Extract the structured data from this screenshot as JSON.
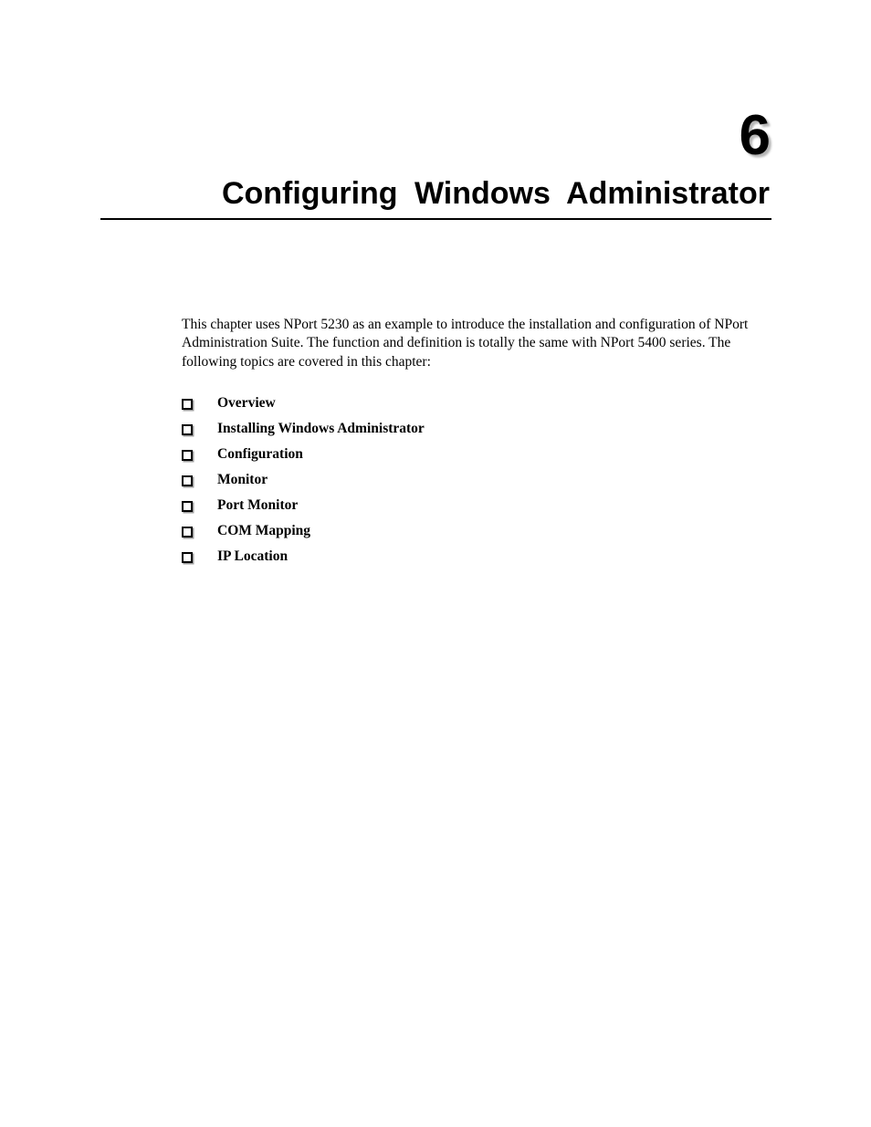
{
  "document": {
    "chapter_number": "6",
    "chapter_title": "Configuring Windows Administrator"
  },
  "intro": {
    "paragraph": "This chapter uses NPort 5230 as an example to introduce the installation and configuration of NPort Administration Suite. The function and definition is totally the same with NPort 5400 series. The following topics are covered in this chapter:"
  },
  "topics": {
    "items": [
      {
        "label": "Overview",
        "bullet": "hollow-square-bullet"
      },
      {
        "label": "Installing Windows Administrator",
        "bullet": "hollow-square-bullet"
      },
      {
        "label": "Configuration",
        "bullet": "hollow-square-bullet"
      },
      {
        "label": "Monitor",
        "bullet": "hollow-square-bullet"
      },
      {
        "label": "Port Monitor",
        "bullet": "hollow-square-bullet"
      },
      {
        "label": "COM Mapping",
        "bullet": "hollow-square-bullet"
      },
      {
        "label": "IP Location",
        "bullet": "hollow-square-bullet"
      }
    ]
  },
  "colors": {
    "page_background": "#ffffff",
    "text": "#000000",
    "rule": "#000000"
  }
}
